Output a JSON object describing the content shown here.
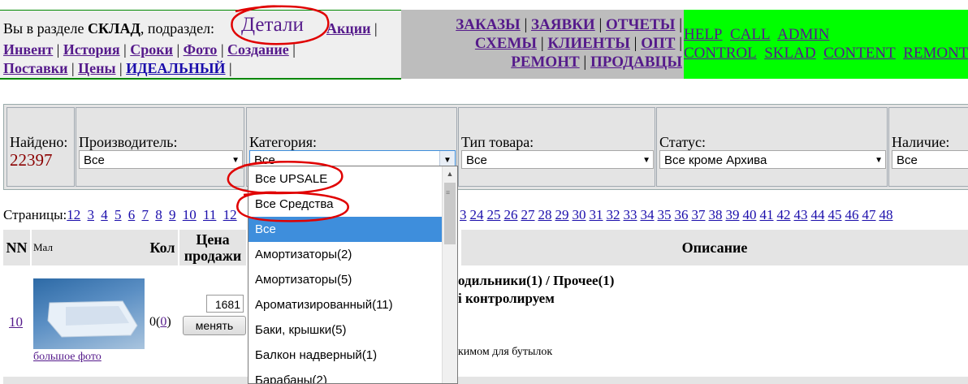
{
  "header": {
    "location_prefix": "Вы в разделе",
    "section": "СКЛАД",
    "subsection_prefix": ", подраздел:",
    "current": "Детали",
    "links_row1": [
      "Акции"
    ],
    "links_row2": [
      "Инвент",
      "История",
      "Сроки",
      "Фото",
      "Создание"
    ],
    "links_row3": [
      "Поставки",
      "Цены",
      "ИДЕАЛЬНЫЙ"
    ],
    "main_nav": [
      [
        "ЗАКАЗЫ",
        "ЗАЯВКИ",
        "ОТЧЕТЫ"
      ],
      [
        "СХЕМЫ",
        "КЛИЕНТЫ",
        "ОПТ"
      ],
      [
        "РЕМОНТ",
        "ПРОДАВЦЫ"
      ]
    ],
    "right_nav": [
      [
        "HELP",
        "CALL",
        "ADMIN"
      ],
      [
        "CONTROL",
        "SKLAD",
        "CONTENT",
        "REMONT"
      ]
    ]
  },
  "filters": {
    "found_label": "Найдено:",
    "found_count": "22397",
    "manufacturer": {
      "label": "Производитель:",
      "value": "Все"
    },
    "category": {
      "label": "Категория:",
      "value": "Все"
    },
    "type": {
      "label": "Тип товара:",
      "value": "Все"
    },
    "status": {
      "label": "Статус:",
      "value": "Все кроме Архива"
    },
    "availability": {
      "label": "Наличие:",
      "value": "Все"
    }
  },
  "pages": {
    "label": "Страницы:",
    "left": [
      "12",
      "3",
      "4",
      "5",
      "6",
      "7",
      "8",
      "9",
      "10",
      "11",
      "12"
    ],
    "right": [
      "3",
      "24",
      "25",
      "26",
      "27",
      "28",
      "29",
      "30",
      "31",
      "32",
      "33",
      "34",
      "35",
      "36",
      "37",
      "38",
      "39",
      "40",
      "41",
      "42",
      "43",
      "44",
      "45",
      "46",
      "47",
      "48"
    ]
  },
  "table": {
    "headers": {
      "nn": "NN",
      "thumb": "Мал",
      "qty": "Кол",
      "price": "Цена продажи",
      "description": "Описание"
    },
    "row": {
      "nn": "10",
      "photo_link": "большое фото",
      "qty": "0(",
      "qty_link": "0",
      "qty_close": ")",
      "price": "1681",
      "change_button": "менять",
      "desc_line1": "одильники(1) / Прочее(1)",
      "desc_line2": "і контролируем",
      "desc_line3": "кимом для бутылок"
    }
  },
  "dropdown": {
    "options": [
      "Все UPSALE",
      "Все Средства",
      "Все",
      "Амортизаторы(2)",
      "Амортизаторы(5)",
      "Ароматизированный(11)",
      "Баки, крышки(5)",
      "Балкон надверный(1)",
      "Барабаны(2)"
    ],
    "selected_index": 2
  },
  "colors": {
    "green_bar": "#00ff00",
    "gray_bar": "#bdbdbd",
    "selected": "#3e8edc",
    "annotation": "#e00000",
    "found_count": "#8b0000"
  }
}
